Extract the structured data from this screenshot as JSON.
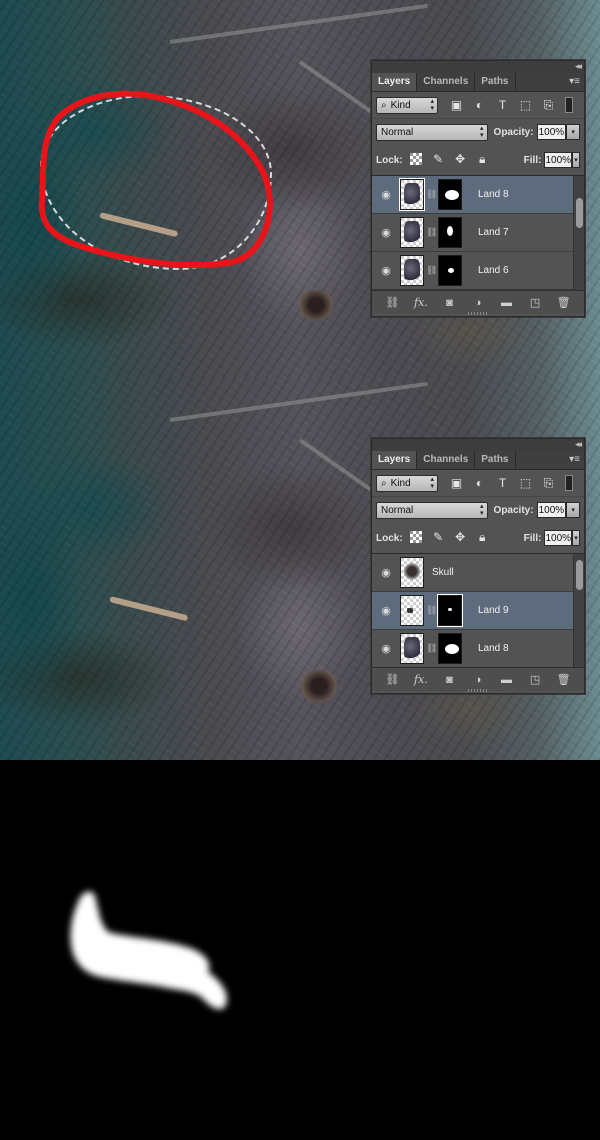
{
  "panels": [
    {
      "tabs": [
        "Layers",
        "Channels",
        "Paths"
      ],
      "filter": {
        "kind_label": "Kind"
      },
      "blend_mode": "Normal",
      "opacity_label": "Opacity:",
      "opacity_value": "100%",
      "lock_label": "Lock:",
      "fill_label": "Fill:",
      "fill_value": "100%",
      "layers": [
        {
          "name": "Land 8",
          "selected": true,
          "has_mask": true
        },
        {
          "name": "Land 7",
          "selected": false,
          "has_mask": true
        },
        {
          "name": "Land 6",
          "selected": false,
          "has_mask": true
        }
      ]
    },
    {
      "tabs": [
        "Layers",
        "Channels",
        "Paths"
      ],
      "filter": {
        "kind_label": "Kind"
      },
      "blend_mode": "Normal",
      "opacity_label": "Opacity:",
      "opacity_value": "100%",
      "lock_label": "Lock:",
      "fill_label": "Fill:",
      "fill_value": "100%",
      "layers": [
        {
          "name": "Skull",
          "selected": false,
          "has_mask": false
        },
        {
          "name": "Land 9",
          "selected": true,
          "has_mask": true
        },
        {
          "name": "Land 8",
          "selected": false,
          "has_mask": true
        }
      ]
    }
  ],
  "icons": {
    "eye": "eye-icon",
    "link": "link-icon",
    "footer": [
      "link-layers-icon",
      "fx-icon",
      "add-mask-icon",
      "adjustment-layer-icon",
      "new-group-icon",
      "new-layer-icon",
      "trash-icon"
    ]
  },
  "colors": {
    "selection_highlight": "#5d6b7d",
    "panel_bg": "#535353",
    "freehand_outline": "#e8141a"
  }
}
